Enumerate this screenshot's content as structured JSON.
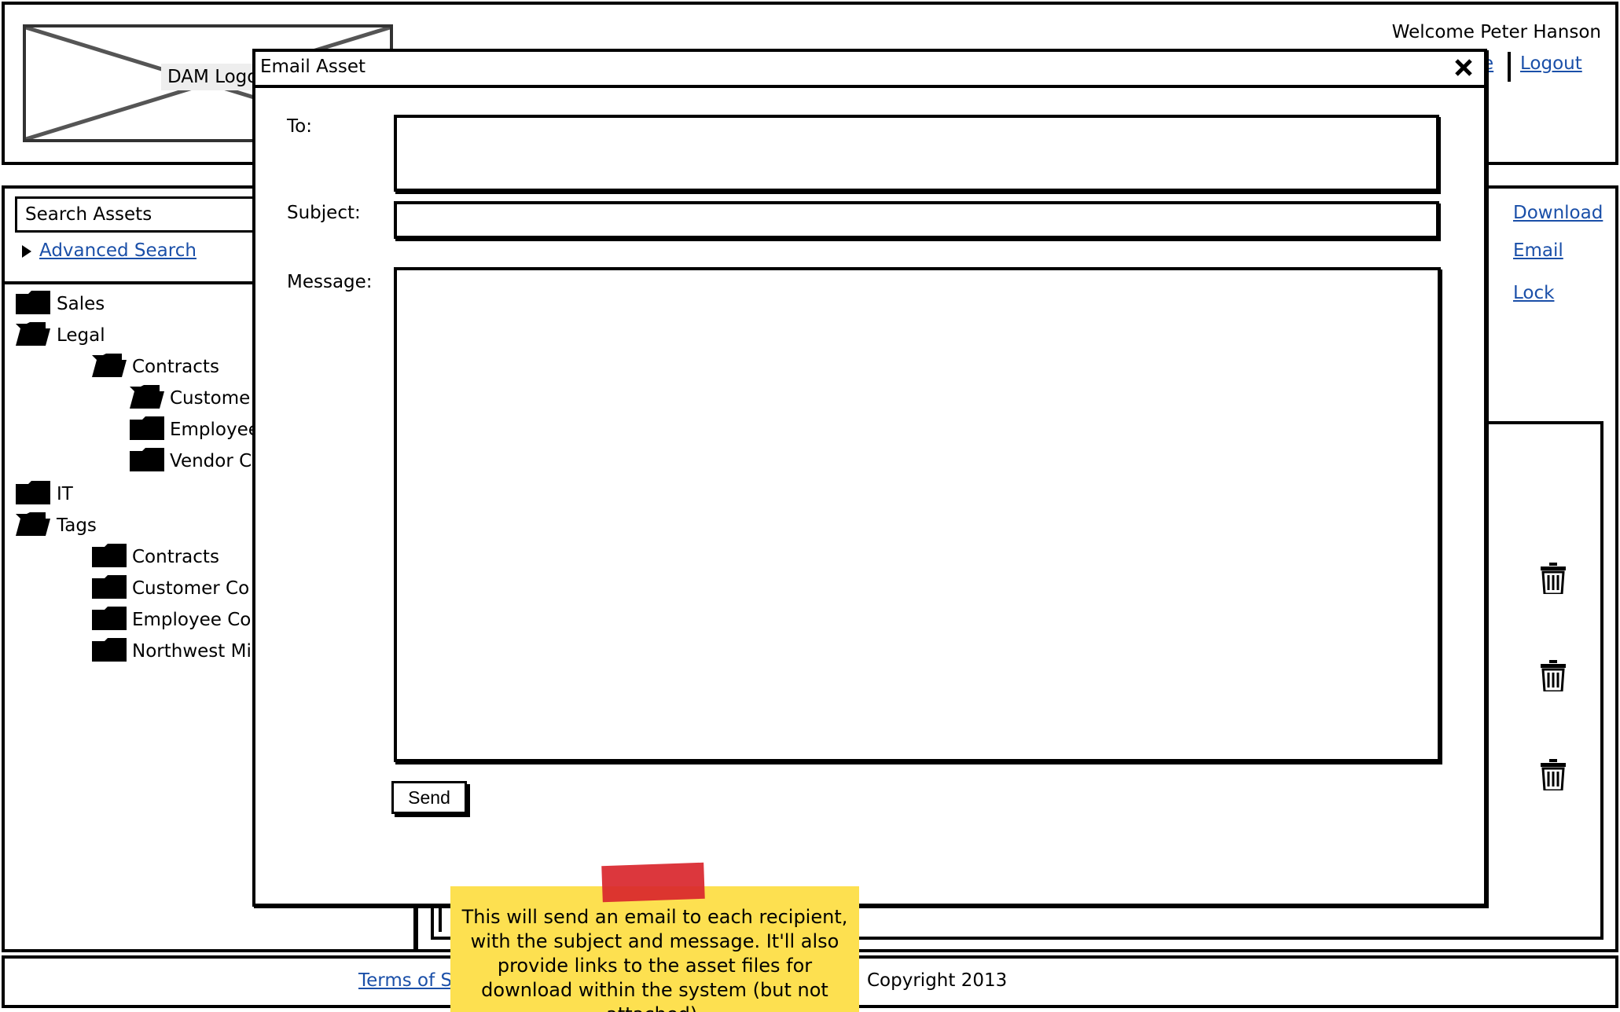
{
  "header": {
    "logo_text": "DAM Logo",
    "welcome": "Welcome Peter Hanson",
    "partial_link": "e",
    "logout": "Logout"
  },
  "sidebar": {
    "search_placeholder": "Search Assets",
    "advanced_search": "Advanced Search",
    "tree": [
      {
        "label": "Sales",
        "icon": "folder-closed-icon"
      },
      {
        "label": "Legal",
        "icon": "folder-open-icon"
      },
      {
        "label": "Contracts",
        "icon": "folder-open-icon"
      },
      {
        "label": "Custome",
        "icon": "folder-open-icon"
      },
      {
        "label": "Employee",
        "icon": "folder-closed-icon"
      },
      {
        "label": "Vendor C",
        "icon": "folder-closed-icon"
      },
      {
        "label": "IT",
        "icon": "folder-closed-icon"
      },
      {
        "label": "Tags",
        "icon": "folder-open-icon"
      },
      {
        "label": "Contracts",
        "icon": "folder-closed-icon"
      },
      {
        "label": "Customer Co",
        "icon": "folder-closed-icon"
      },
      {
        "label": "Employee Co",
        "icon": "folder-closed-icon"
      },
      {
        "label": "Northwest Mil",
        "icon": "folder-closed-icon"
      }
    ]
  },
  "actions": {
    "download": "Download",
    "email": "Email",
    "lock": "Lock"
  },
  "modal": {
    "title": "Email Asset",
    "close_icon": "close-icon",
    "to_label": "To:",
    "to_value": "",
    "subject_label": "Subject:",
    "subject_value": "",
    "message_label": "Message:",
    "message_value": "",
    "send_label": "Send"
  },
  "footer": {
    "terms": "Terms of S",
    "copyright": "Copyright 2013"
  },
  "note": {
    "text": "This will send an email to each recipient, with the subject and message. It'll also provide links to the asset files for download within the system (but not attached)."
  },
  "colors": {
    "link": "#1a4fa8",
    "note": "#fde050",
    "tape": "#d9262c"
  }
}
